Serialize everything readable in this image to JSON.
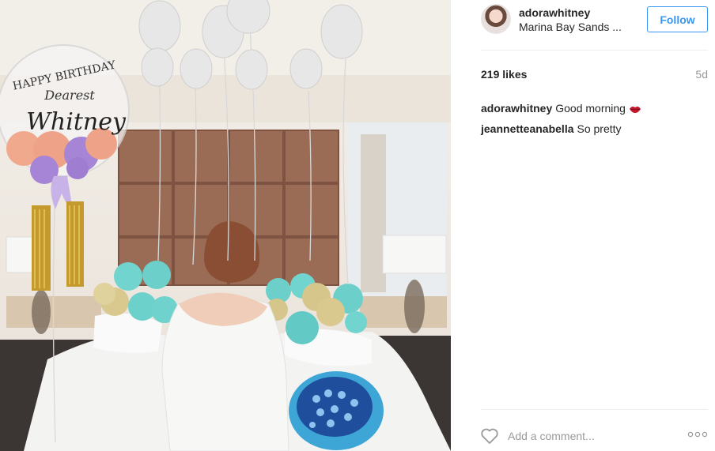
{
  "photo": {
    "balloon_text_line1": "HAPPY BIRTHDAY",
    "balloon_text_line2": "Dearest",
    "balloon_text_line3": "Whitney"
  },
  "post": {
    "username": "adorawhitney",
    "location": "Marina Bay Sands ...",
    "follow_label": "Follow",
    "likes": "219 likes",
    "time": "5d",
    "comments": [
      {
        "author": "adorawhitney",
        "text": "Good morning",
        "emoji": "lips-icon"
      },
      {
        "author": "jeannetteanabella",
        "text": "So pretty"
      }
    ],
    "comment_placeholder": "Add a comment..."
  },
  "colors": {
    "accent": "#3897f0",
    "muted": "#999999",
    "text": "#262626"
  }
}
